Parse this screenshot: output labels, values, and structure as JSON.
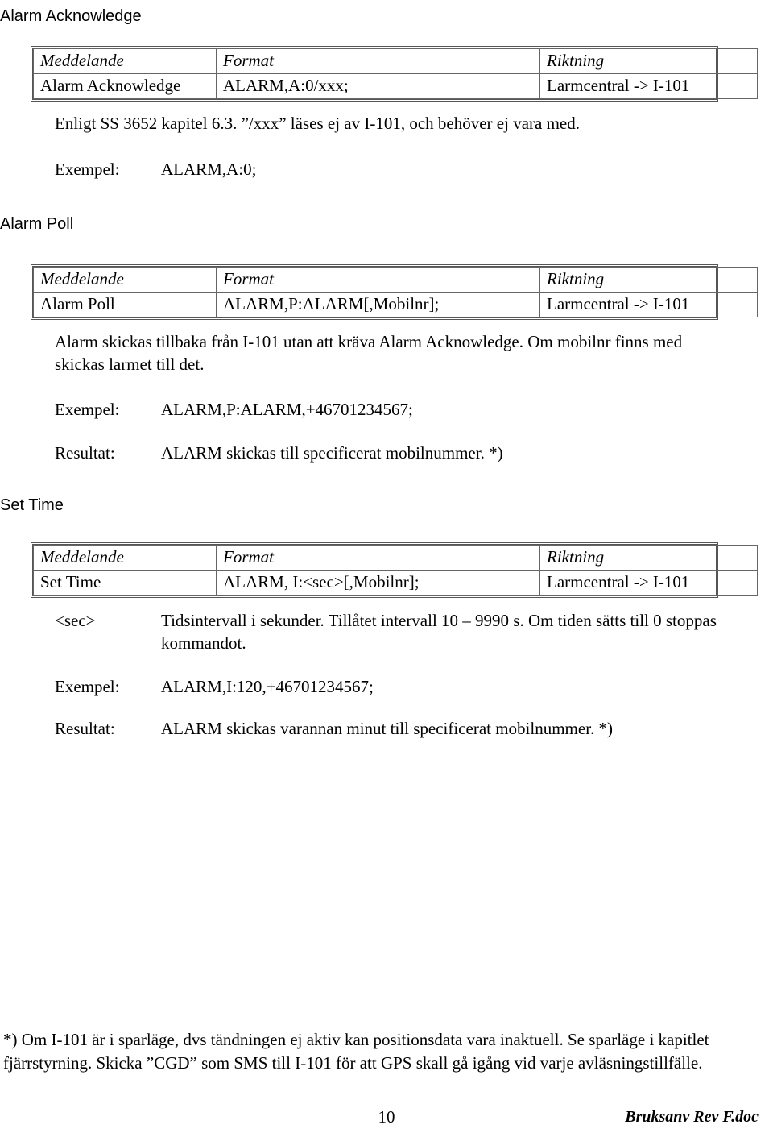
{
  "document": {
    "page_number": "10",
    "doc_name": "Bruksanv Rev F.doc"
  },
  "table_headers": {
    "message": "Meddelande",
    "format": "Format",
    "direction": "Riktning"
  },
  "sections": [
    {
      "heading": "Alarm Acknowledge",
      "row": {
        "message": "Alarm Acknowledge",
        "format": "ALARM,A:0/xxx;",
        "direction": "Larmcentral -> I-101"
      },
      "description": "Enligt SS 3652 kapitel 6.3. ”/xxx” läses ej av I-101, och behöver ej vara med.",
      "example_label": "Exempel:",
      "example_value": "ALARM,A:0;"
    },
    {
      "heading": "Alarm Poll",
      "row": {
        "message": "Alarm Poll",
        "format": "ALARM,P:ALARM[,Mobilnr];",
        "direction": "Larmcentral -> I-101"
      },
      "description": "Alarm skickas tillbaka från I-101 utan att kräva Alarm Acknowledge. Om mobilnr finns med skickas larmet till det.",
      "example_label": "Exempel:",
      "example_value": "ALARM,P:ALARM,+46701234567;",
      "result_label": "Resultat:",
      "result_value": "ALARM skickas till specificerat mobilnummer. *)"
    },
    {
      "heading": "Set Time",
      "row": {
        "message": "Set Time",
        "format": "ALARM, I:<sec>[,Mobilnr];",
        "direction": "Larmcentral -> I-101"
      },
      "param_label": "<sec>",
      "param_value": "Tidsintervall i sekunder. Tillåtet intervall 10 – 9990 s. Om tiden sätts till 0 stoppas kommandot.",
      "example_label": "Exempel:",
      "example_value": "ALARM,I:120,+46701234567;",
      "result_label": "Resultat:",
      "result_value": "ALARM skickas varannan minut till specificerat mobilnummer. *)"
    }
  ],
  "footnote": "*) Om I-101 är i sparläge, dvs tändningen ej aktiv kan positionsdata vara inaktuell. Se sparläge i kapitlet fjärrstyrning. Skicka ”CGD” som SMS till I-101 för att GPS skall gå igång vid varje avläsningstillfälle."
}
